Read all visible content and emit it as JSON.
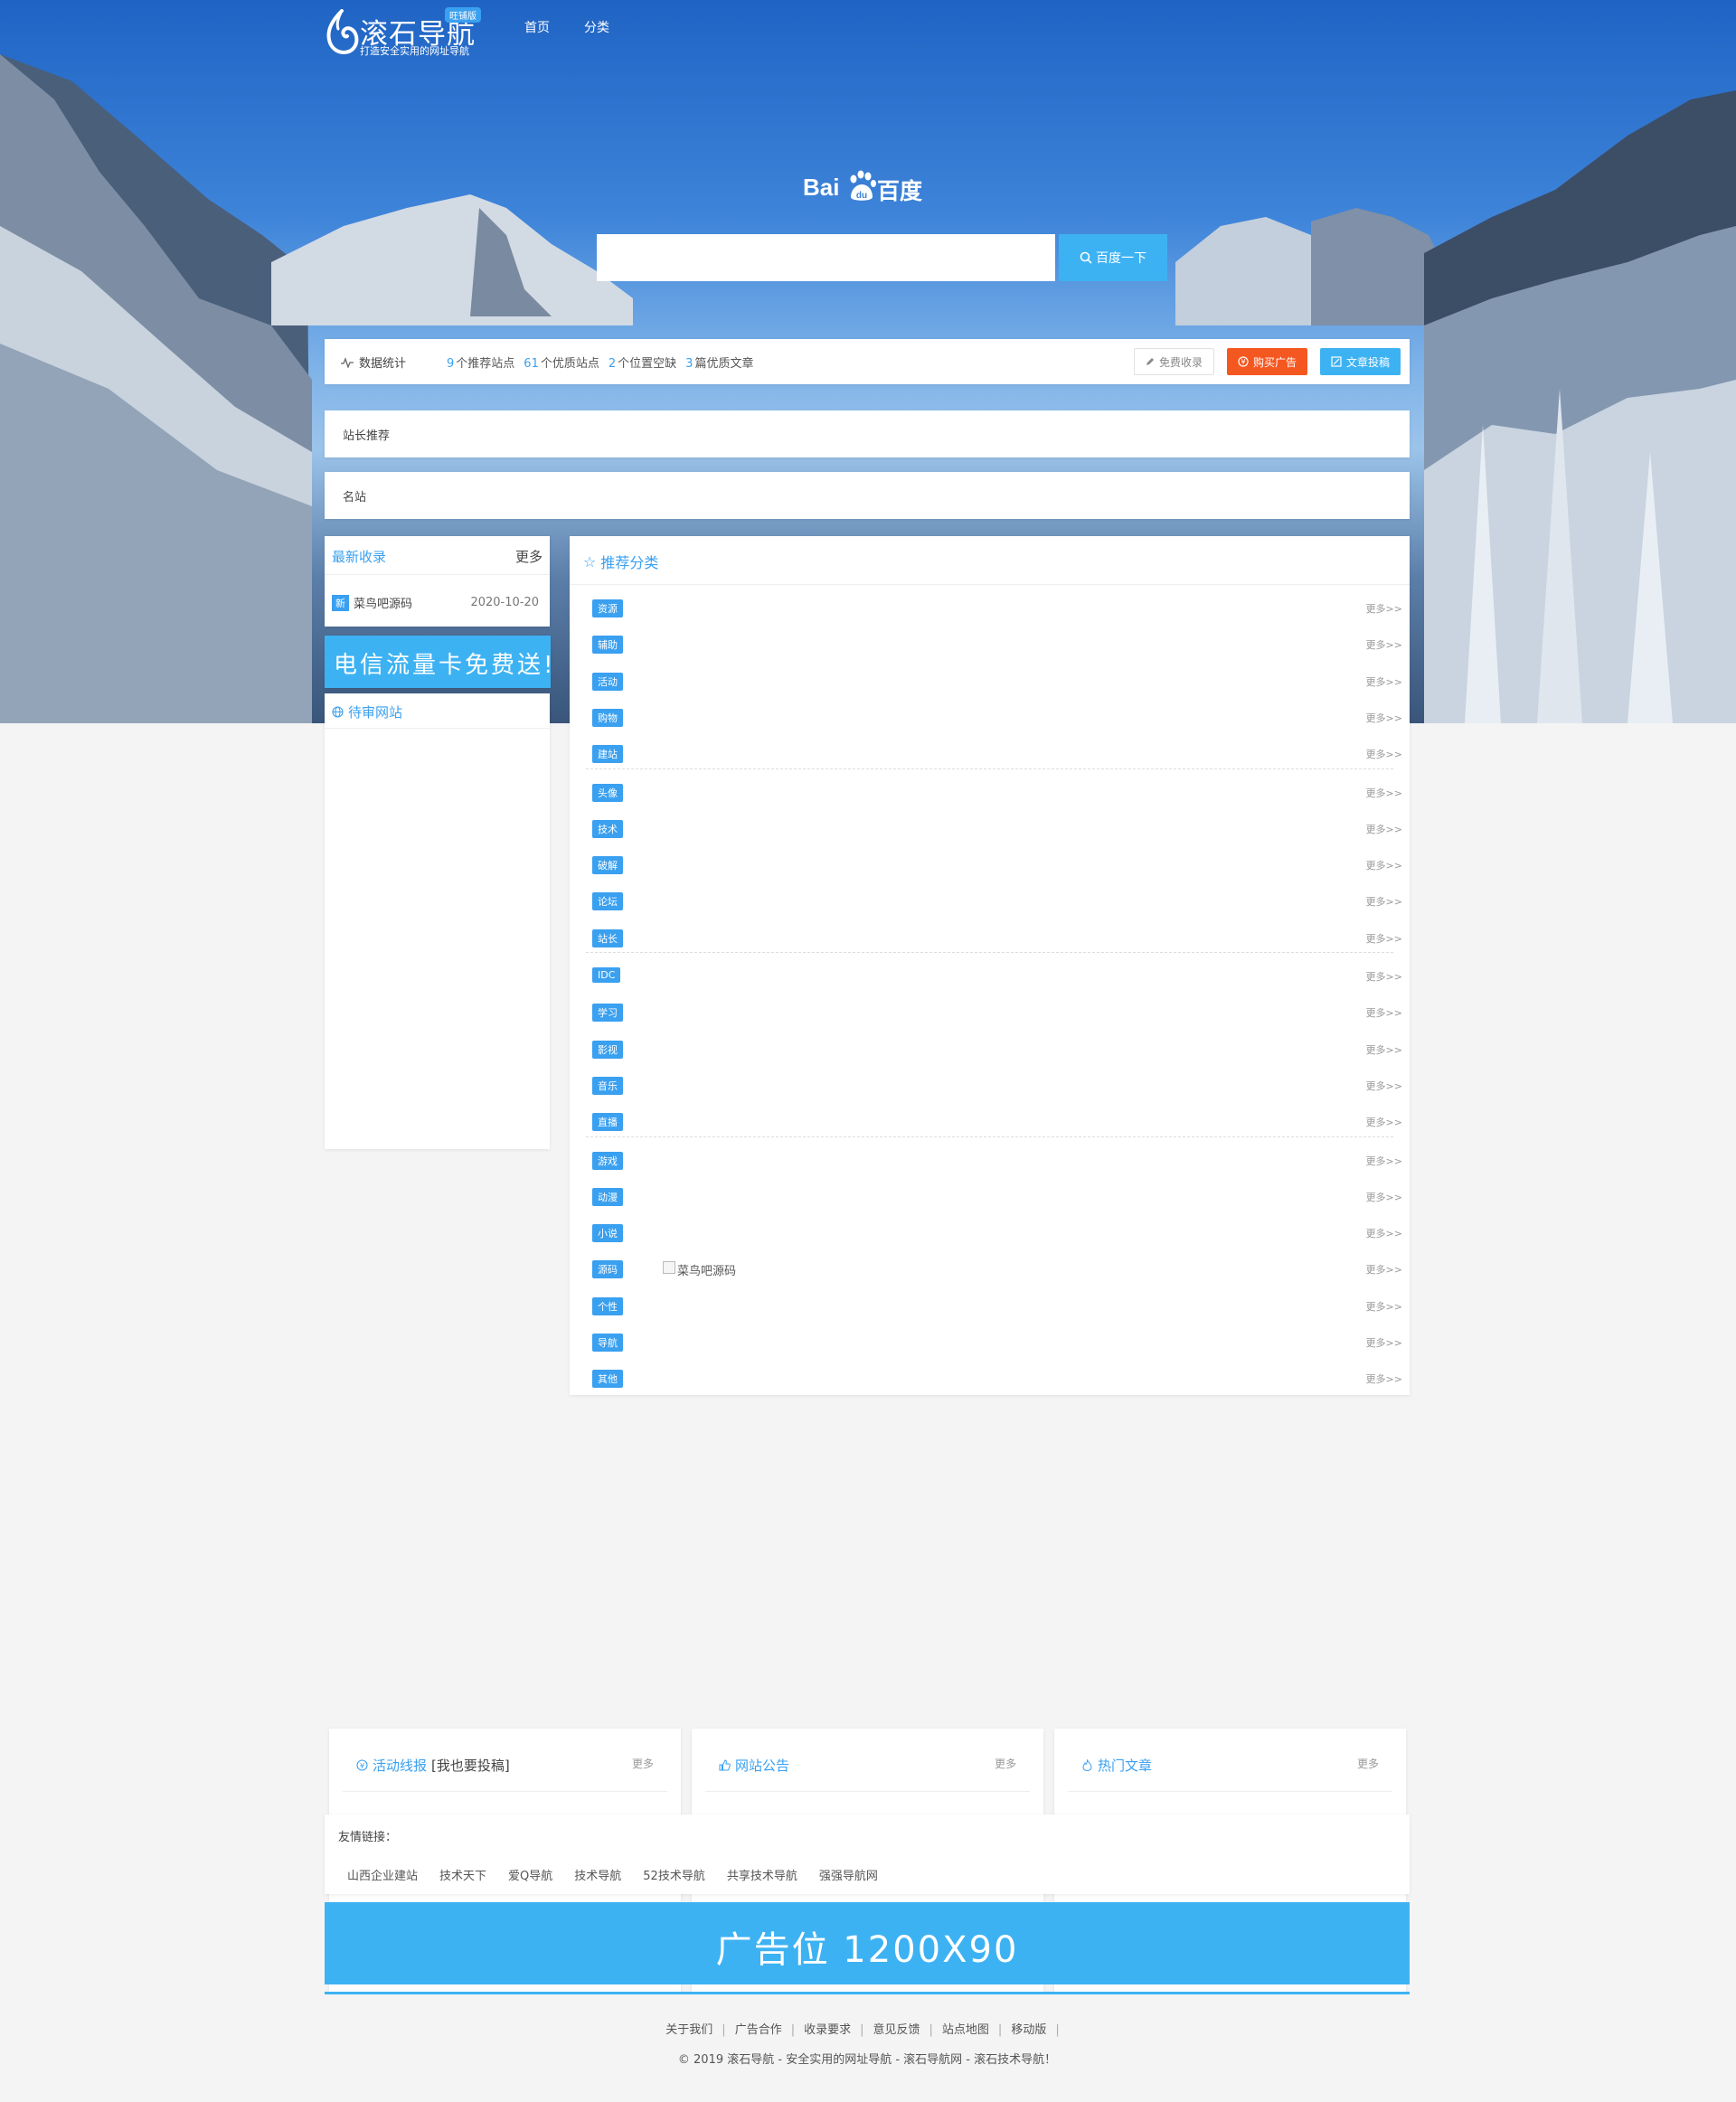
{
  "header": {
    "logo_text": "滚石导航",
    "logo_badge": "旺铺版",
    "logo_slogan": "打造安全实用的网址导航",
    "nav": [
      "首页",
      "分类"
    ]
  },
  "search": {
    "engine_logo_latin": "Bai",
    "engine_logo_paw": "du",
    "engine_logo_cn": "百度",
    "placeholder": "",
    "button_label": "百度一下"
  },
  "stats": {
    "label": "数据统计",
    "items": [
      {
        "num": "9",
        "text": "个推荐站点"
      },
      {
        "num": "61",
        "text": "个优质站点"
      },
      {
        "num": "2",
        "text": "个位置空缺"
      },
      {
        "num": "3",
        "text": "篇优质文章"
      }
    ],
    "buttons": {
      "free": "免费收录",
      "buy": "购买广告",
      "post": "文章投稿"
    }
  },
  "bars": {
    "recommend": "站长推荐",
    "famous": "名站"
  },
  "latest": {
    "title": "最新收录",
    "more": "更多",
    "items": [
      {
        "badge": "新",
        "name": "菜鸟吧源码",
        "date": "2020-10-20"
      }
    ]
  },
  "ad_card": "电信流量卡免费送!",
  "pending": {
    "title": "待审网站"
  },
  "categories": {
    "title": "推荐分类",
    "more_label": "更多>>",
    "groups": [
      [
        "资源",
        "辅助",
        "活动",
        "购物",
        "建站"
      ],
      [
        "头像",
        "技术",
        "破解",
        "论坛",
        "站长"
      ],
      [
        "IDC",
        "学习",
        "影视",
        "音乐",
        "直播"
      ],
      [
        "游戏",
        "动漫",
        "小说",
        "源码",
        "个性",
        "导航",
        "其他"
      ]
    ],
    "broken_image_alt": "菜鸟吧源码"
  },
  "columns": [
    {
      "title": "活动线报",
      "title_extra": "[我也要投稿]",
      "more": "更多"
    },
    {
      "title": "网站公告",
      "title_extra": "",
      "more": "更多"
    },
    {
      "title": "热门文章",
      "title_extra": "",
      "more": "更多"
    }
  ],
  "friend_links": {
    "title": "友情链接：",
    "items": [
      "山西企业建站",
      "技术天下",
      "爱Q导航",
      "技术导航",
      "52技术导航",
      "共享技术导航",
      "强强导航网"
    ]
  },
  "banner": "广告位  1200X90",
  "footer": {
    "nav": [
      "关于我们",
      "广告合作",
      "收录要求",
      "意见反馈",
      "站点地图",
      "移动版"
    ],
    "copyright": "© 2019 滚石导航 - 安全实用的网址导航 - 滚石导航网 - 滚石技术导航！"
  },
  "colors": {
    "accent": "#3aa0f0",
    "button_blue": "#3db2f3",
    "button_orange": "#f55721"
  }
}
